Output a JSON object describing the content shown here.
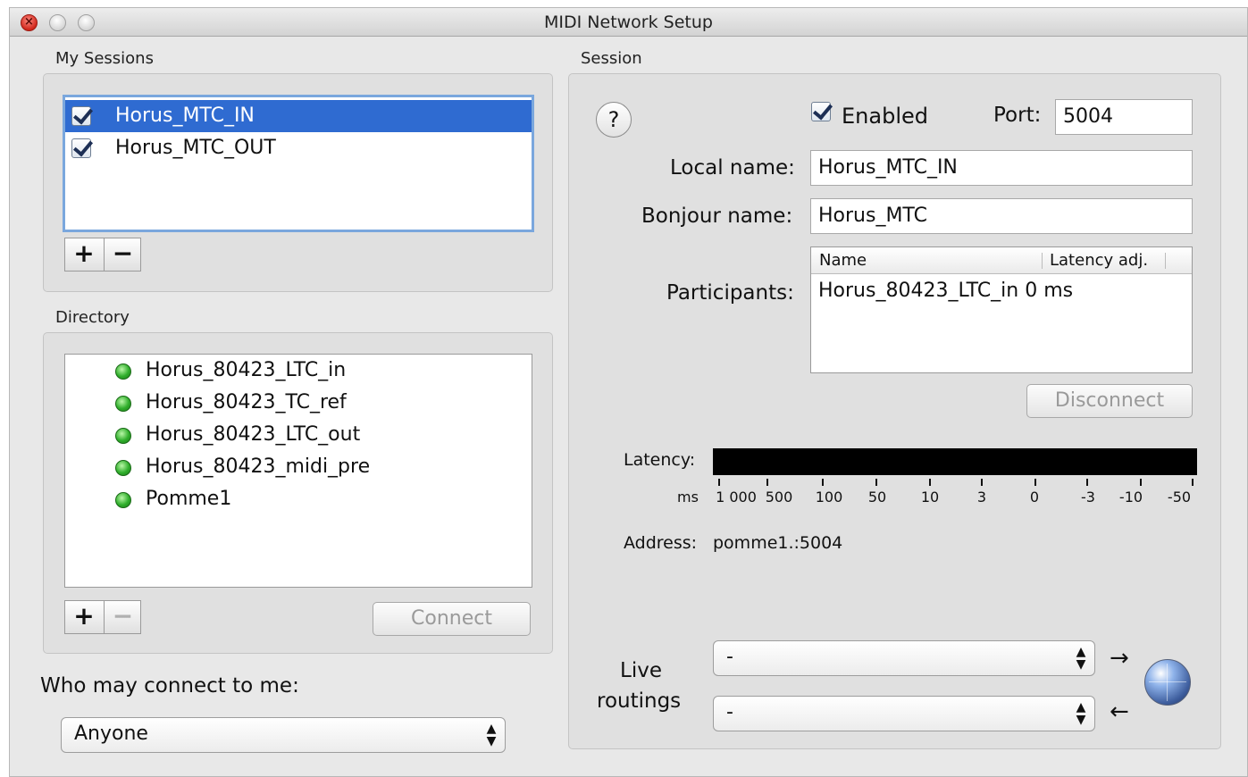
{
  "window": {
    "title": "MIDI Network Setup"
  },
  "my_sessions": {
    "label": "My Sessions",
    "items": [
      {
        "label": "Horus_MTC_IN",
        "checked": true,
        "selected": true
      },
      {
        "label": "Horus_MTC_OUT",
        "checked": true,
        "selected": false
      }
    ],
    "add_label": "+",
    "remove_label": "−"
  },
  "directory": {
    "label": "Directory",
    "items": [
      {
        "label": "Horus_80423_LTC_in",
        "status": "green"
      },
      {
        "label": "Horus_80423_TC_ref",
        "status": "green"
      },
      {
        "label": "Horus_80423_LTC_out",
        "status": "green"
      },
      {
        "label": "Horus_80423_midi_pre",
        "status": "green"
      },
      {
        "label": "Pomme1",
        "status": "green"
      }
    ],
    "add_label": "+",
    "remove_label": "−",
    "connect_label": "Connect"
  },
  "who_may_connect": {
    "label": "Who may connect to me:",
    "value": "Anyone"
  },
  "session": {
    "label": "Session",
    "help_label": "?",
    "enabled_label": "Enabled",
    "enabled": true,
    "port_label": "Port:",
    "port_value": "5004",
    "local_name_label": "Local name:",
    "local_name_value": "Horus_MTC_IN",
    "bonjour_name_label": "Bonjour name:",
    "bonjour_name_value": "Horus_MTC",
    "participants_label": "Participants:",
    "participants_columns": [
      "Name",
      "Latency adj."
    ],
    "participants_rows": [
      {
        "name": "Horus_80423_LTC_in",
        "latency": "0 ms"
      }
    ],
    "disconnect_label": "Disconnect",
    "latency_label": "Latency:",
    "latency_unit": "ms",
    "latency_ticks": [
      "1 000",
      "500",
      "100",
      "50",
      "10",
      "3",
      "0",
      "-3",
      "-10",
      "-50"
    ],
    "address_label": "Address:",
    "address_value": "pomme1.:5004",
    "live_routings_label_line1": "Live",
    "live_routings_label_line2": "routings",
    "routing_out_value": "-",
    "routing_in_value": "-"
  },
  "colors": {
    "selection": "#2f6bd1",
    "status_green": "#2fae2b",
    "window_bg": "#e8e8e8"
  }
}
